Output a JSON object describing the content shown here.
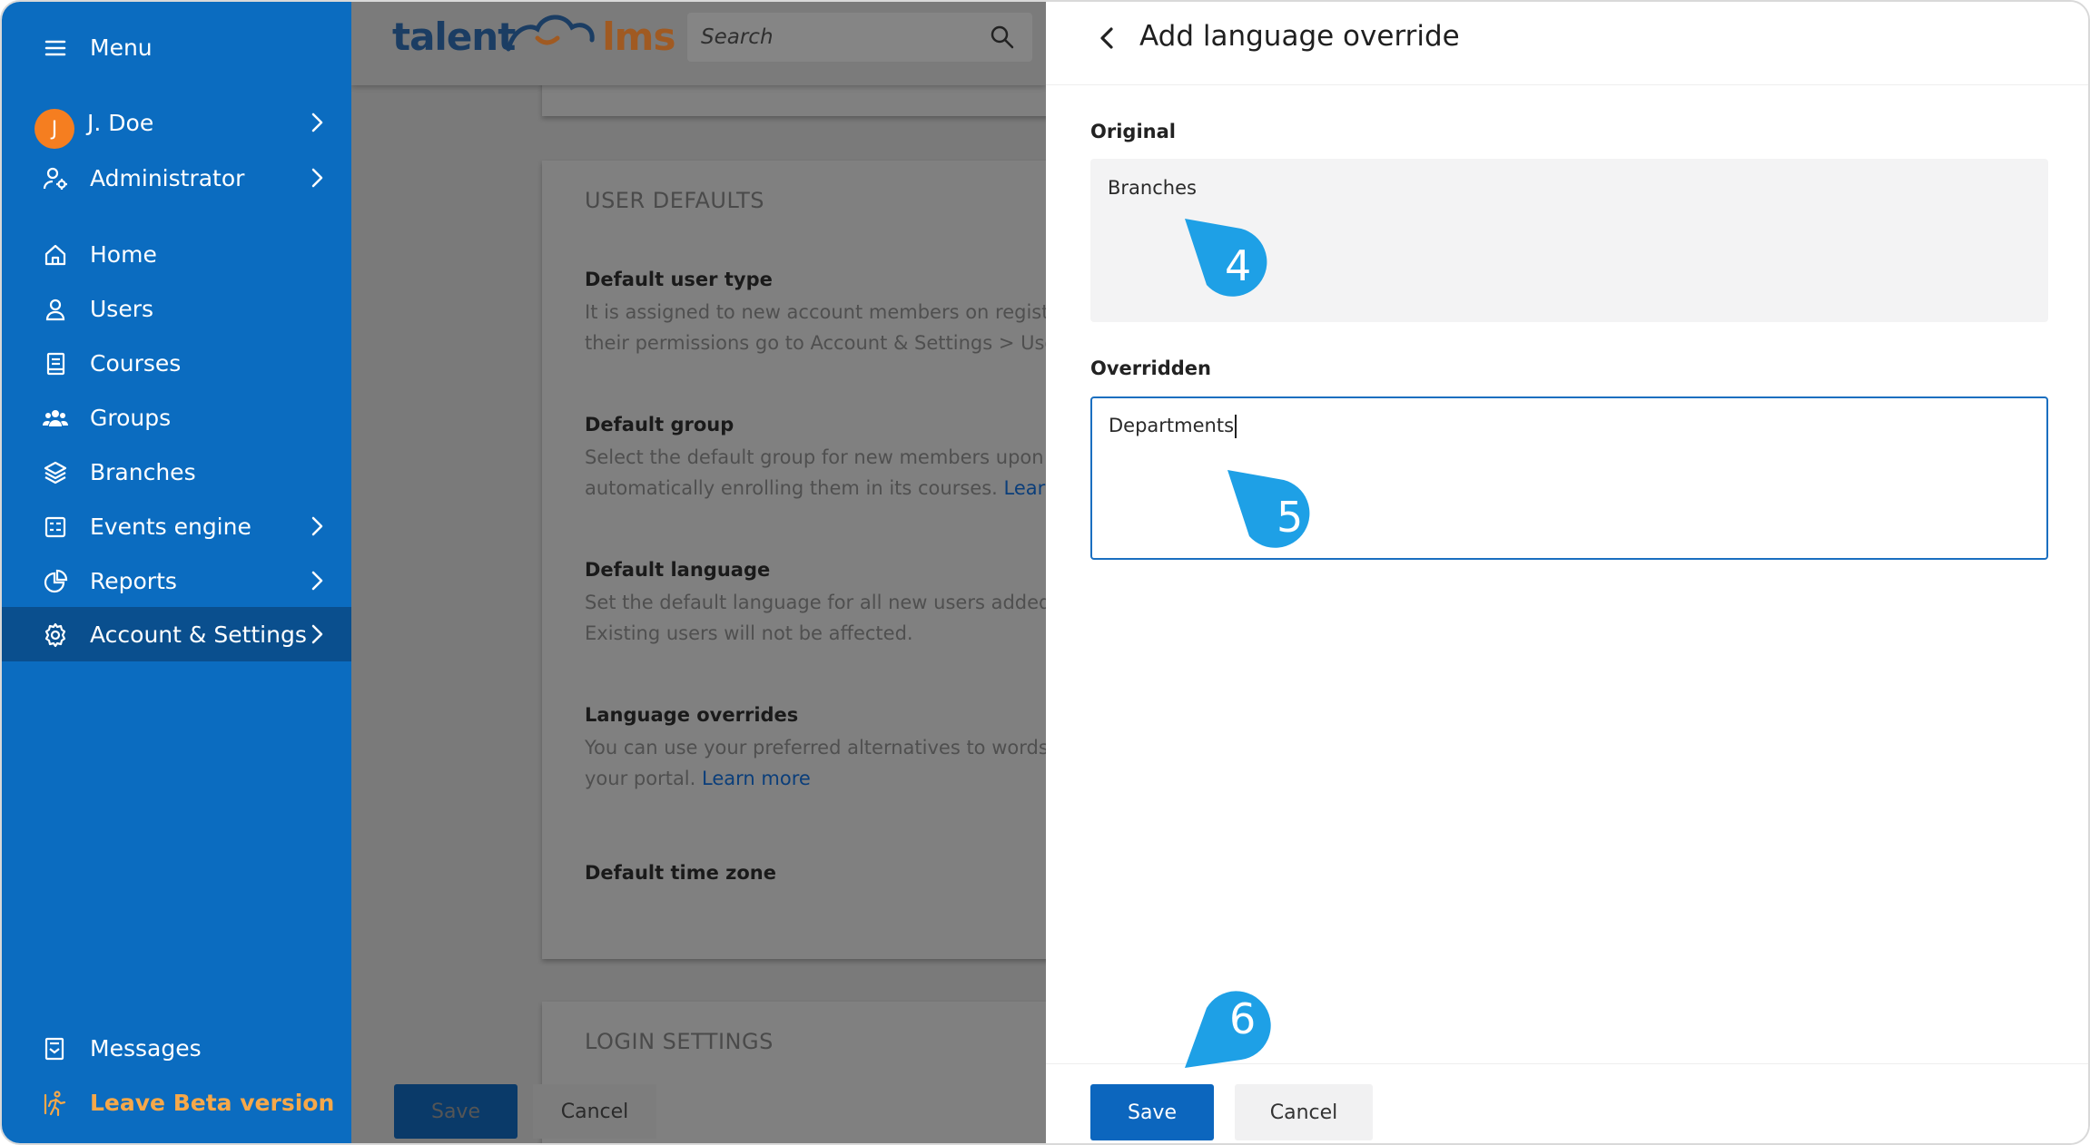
{
  "sidebar": {
    "menu_label": "Menu",
    "user": {
      "initial": "J",
      "name": "J. Doe"
    },
    "role": "Administrator",
    "items": [
      {
        "label": "Home",
        "icon": "home-icon"
      },
      {
        "label": "Users",
        "icon": "user-icon"
      },
      {
        "label": "Courses",
        "icon": "book-icon"
      },
      {
        "label": "Groups",
        "icon": "groups-icon"
      },
      {
        "label": "Branches",
        "icon": "layers-icon"
      },
      {
        "label": "Events engine",
        "icon": "events-icon"
      },
      {
        "label": "Reports",
        "icon": "pie-chart-icon"
      },
      {
        "label": "Account & Settings",
        "icon": "gear-icon"
      }
    ],
    "messages": "Messages",
    "leave_beta": "Leave Beta version"
  },
  "background": {
    "logo": {
      "talent": "talent",
      "lms": "lms"
    },
    "search_placeholder": "Search",
    "section_title": "USER DEFAULTS",
    "default_user_type": {
      "label": "Default user type",
      "desc1": "It is assigned to new account members on registrati",
      "desc2": "their permissions go to Account & Settings > User ty"
    },
    "default_group": {
      "label": "Default group",
      "desc1": "Select the default group for new members upon regi",
      "desc2": "automatically enrolling them in its courses.",
      "link": "Learn mo"
    },
    "default_language": {
      "label": "Default language",
      "desc1": "Set the default language for all new users added to",
      "desc2": "Existing users will not be affected."
    },
    "language_overrides": {
      "label": "Language overrides",
      "desc1": "You can use your preferred alternatives to words or p",
      "desc2": "your portal.",
      "link": "Learn more"
    },
    "default_time_zone": {
      "label": "Default time zone"
    },
    "login_settings": "LOGIN SETTINGS",
    "save_label": "Save",
    "cancel_label": "Cancel"
  },
  "panel": {
    "title": "Add language override",
    "original_label": "Original",
    "original_value": "Branches",
    "overridden_label": "Overridden",
    "overridden_value": "Departments",
    "save_label": "Save",
    "cancel_label": "Cancel"
  },
  "callouts": [
    "4",
    "5",
    "6"
  ],
  "colors": {
    "sidebar_bg": "#0b6cc0",
    "sidebar_active": "#0a4f8e",
    "primary": "#0c66be",
    "callout": "#1ea0e6",
    "beta": "#f7a849"
  }
}
